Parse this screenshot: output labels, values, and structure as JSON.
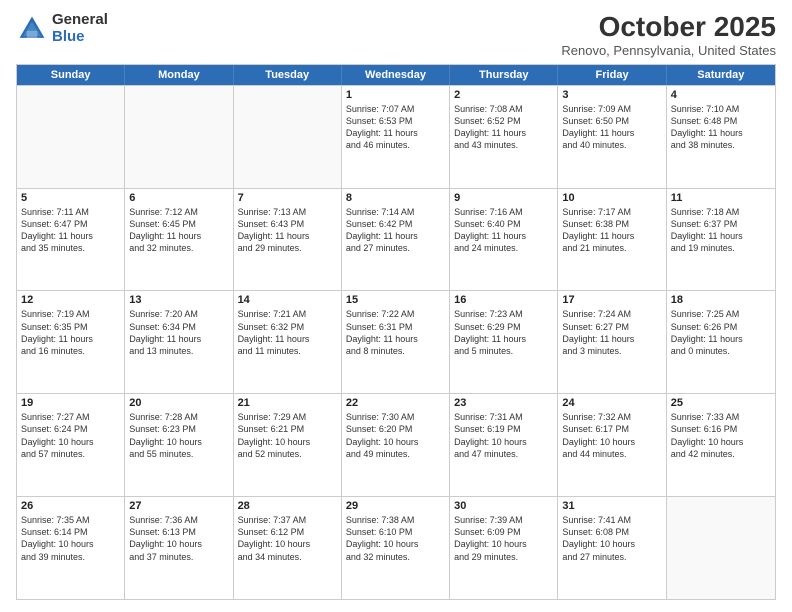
{
  "logo": {
    "general": "General",
    "blue": "Blue"
  },
  "header": {
    "month": "October 2025",
    "location": "Renovo, Pennsylvania, United States"
  },
  "days": [
    "Sunday",
    "Monday",
    "Tuesday",
    "Wednesday",
    "Thursday",
    "Friday",
    "Saturday"
  ],
  "weeks": [
    [
      {
        "day": "",
        "empty": true
      },
      {
        "day": "",
        "empty": true
      },
      {
        "day": "",
        "empty": true
      },
      {
        "day": "1",
        "lines": [
          "Sunrise: 7:07 AM",
          "Sunset: 6:53 PM",
          "Daylight: 11 hours",
          "and 46 minutes."
        ]
      },
      {
        "day": "2",
        "lines": [
          "Sunrise: 7:08 AM",
          "Sunset: 6:52 PM",
          "Daylight: 11 hours",
          "and 43 minutes."
        ]
      },
      {
        "day": "3",
        "lines": [
          "Sunrise: 7:09 AM",
          "Sunset: 6:50 PM",
          "Daylight: 11 hours",
          "and 40 minutes."
        ]
      },
      {
        "day": "4",
        "lines": [
          "Sunrise: 7:10 AM",
          "Sunset: 6:48 PM",
          "Daylight: 11 hours",
          "and 38 minutes."
        ]
      }
    ],
    [
      {
        "day": "5",
        "lines": [
          "Sunrise: 7:11 AM",
          "Sunset: 6:47 PM",
          "Daylight: 11 hours",
          "and 35 minutes."
        ]
      },
      {
        "day": "6",
        "lines": [
          "Sunrise: 7:12 AM",
          "Sunset: 6:45 PM",
          "Daylight: 11 hours",
          "and 32 minutes."
        ]
      },
      {
        "day": "7",
        "lines": [
          "Sunrise: 7:13 AM",
          "Sunset: 6:43 PM",
          "Daylight: 11 hours",
          "and 29 minutes."
        ]
      },
      {
        "day": "8",
        "lines": [
          "Sunrise: 7:14 AM",
          "Sunset: 6:42 PM",
          "Daylight: 11 hours",
          "and 27 minutes."
        ]
      },
      {
        "day": "9",
        "lines": [
          "Sunrise: 7:16 AM",
          "Sunset: 6:40 PM",
          "Daylight: 11 hours",
          "and 24 minutes."
        ]
      },
      {
        "day": "10",
        "lines": [
          "Sunrise: 7:17 AM",
          "Sunset: 6:38 PM",
          "Daylight: 11 hours",
          "and 21 minutes."
        ]
      },
      {
        "day": "11",
        "lines": [
          "Sunrise: 7:18 AM",
          "Sunset: 6:37 PM",
          "Daylight: 11 hours",
          "and 19 minutes."
        ]
      }
    ],
    [
      {
        "day": "12",
        "lines": [
          "Sunrise: 7:19 AM",
          "Sunset: 6:35 PM",
          "Daylight: 11 hours",
          "and 16 minutes."
        ]
      },
      {
        "day": "13",
        "lines": [
          "Sunrise: 7:20 AM",
          "Sunset: 6:34 PM",
          "Daylight: 11 hours",
          "and 13 minutes."
        ]
      },
      {
        "day": "14",
        "lines": [
          "Sunrise: 7:21 AM",
          "Sunset: 6:32 PM",
          "Daylight: 11 hours",
          "and 11 minutes."
        ]
      },
      {
        "day": "15",
        "lines": [
          "Sunrise: 7:22 AM",
          "Sunset: 6:31 PM",
          "Daylight: 11 hours",
          "and 8 minutes."
        ]
      },
      {
        "day": "16",
        "lines": [
          "Sunrise: 7:23 AM",
          "Sunset: 6:29 PM",
          "Daylight: 11 hours",
          "and 5 minutes."
        ]
      },
      {
        "day": "17",
        "lines": [
          "Sunrise: 7:24 AM",
          "Sunset: 6:27 PM",
          "Daylight: 11 hours",
          "and 3 minutes."
        ]
      },
      {
        "day": "18",
        "lines": [
          "Sunrise: 7:25 AM",
          "Sunset: 6:26 PM",
          "Daylight: 11 hours",
          "and 0 minutes."
        ]
      }
    ],
    [
      {
        "day": "19",
        "lines": [
          "Sunrise: 7:27 AM",
          "Sunset: 6:24 PM",
          "Daylight: 10 hours",
          "and 57 minutes."
        ]
      },
      {
        "day": "20",
        "lines": [
          "Sunrise: 7:28 AM",
          "Sunset: 6:23 PM",
          "Daylight: 10 hours",
          "and 55 minutes."
        ]
      },
      {
        "day": "21",
        "lines": [
          "Sunrise: 7:29 AM",
          "Sunset: 6:21 PM",
          "Daylight: 10 hours",
          "and 52 minutes."
        ]
      },
      {
        "day": "22",
        "lines": [
          "Sunrise: 7:30 AM",
          "Sunset: 6:20 PM",
          "Daylight: 10 hours",
          "and 49 minutes."
        ]
      },
      {
        "day": "23",
        "lines": [
          "Sunrise: 7:31 AM",
          "Sunset: 6:19 PM",
          "Daylight: 10 hours",
          "and 47 minutes."
        ]
      },
      {
        "day": "24",
        "lines": [
          "Sunrise: 7:32 AM",
          "Sunset: 6:17 PM",
          "Daylight: 10 hours",
          "and 44 minutes."
        ]
      },
      {
        "day": "25",
        "lines": [
          "Sunrise: 7:33 AM",
          "Sunset: 6:16 PM",
          "Daylight: 10 hours",
          "and 42 minutes."
        ]
      }
    ],
    [
      {
        "day": "26",
        "lines": [
          "Sunrise: 7:35 AM",
          "Sunset: 6:14 PM",
          "Daylight: 10 hours",
          "and 39 minutes."
        ]
      },
      {
        "day": "27",
        "lines": [
          "Sunrise: 7:36 AM",
          "Sunset: 6:13 PM",
          "Daylight: 10 hours",
          "and 37 minutes."
        ]
      },
      {
        "day": "28",
        "lines": [
          "Sunrise: 7:37 AM",
          "Sunset: 6:12 PM",
          "Daylight: 10 hours",
          "and 34 minutes."
        ]
      },
      {
        "day": "29",
        "lines": [
          "Sunrise: 7:38 AM",
          "Sunset: 6:10 PM",
          "Daylight: 10 hours",
          "and 32 minutes."
        ]
      },
      {
        "day": "30",
        "lines": [
          "Sunrise: 7:39 AM",
          "Sunset: 6:09 PM",
          "Daylight: 10 hours",
          "and 29 minutes."
        ]
      },
      {
        "day": "31",
        "lines": [
          "Sunrise: 7:41 AM",
          "Sunset: 6:08 PM",
          "Daylight: 10 hours",
          "and 27 minutes."
        ]
      },
      {
        "day": "",
        "empty": true
      }
    ]
  ]
}
